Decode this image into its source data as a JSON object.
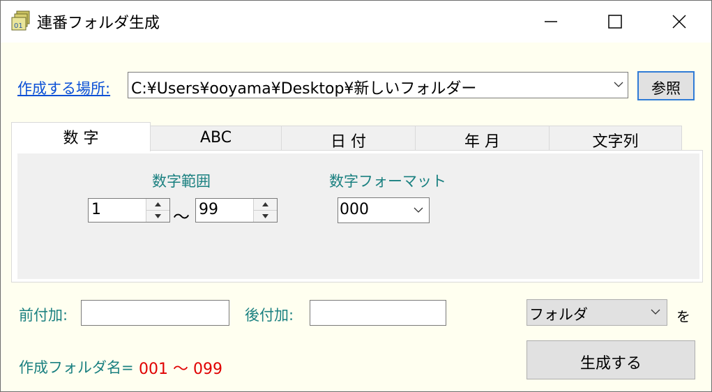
{
  "window": {
    "title": "連番フォルダ生成",
    "icon": "folder-stack-icon",
    "controls": [
      "minimize-icon",
      "maximize-icon",
      "close-icon"
    ]
  },
  "location": {
    "label": "作成する場所:",
    "value": "C:¥Users¥ooyama¥Desktop¥新しいフォルダー",
    "browse_label": "参照"
  },
  "tabs": [
    {
      "label": "数 字",
      "active": true
    },
    {
      "label": "ABC",
      "active": false
    },
    {
      "label": "日 付",
      "active": false
    },
    {
      "label": "年 月",
      "active": false
    },
    {
      "label": "文字列",
      "active": false
    }
  ],
  "number_tab": {
    "range_label": "数字範囲",
    "range_from": "1",
    "range_sep": "～",
    "range_to": "99",
    "format_label": "数字フォーマット",
    "format_value": "000"
  },
  "prefix": {
    "label": "前付加:",
    "value": ""
  },
  "suffix": {
    "label": "後付加:",
    "value": ""
  },
  "target": {
    "type_value": "フォルダ",
    "particle": "を"
  },
  "result": {
    "label": "作成フォルダ名=",
    "value": "001 ～ 099"
  },
  "generate_label": "生成する",
  "colors": {
    "window_bg": "#fffff0",
    "label_teal": "#1a8080",
    "link_blue": "#0a4fd6",
    "result_red": "#e00000",
    "focus_blue": "#2f7bd6"
  }
}
